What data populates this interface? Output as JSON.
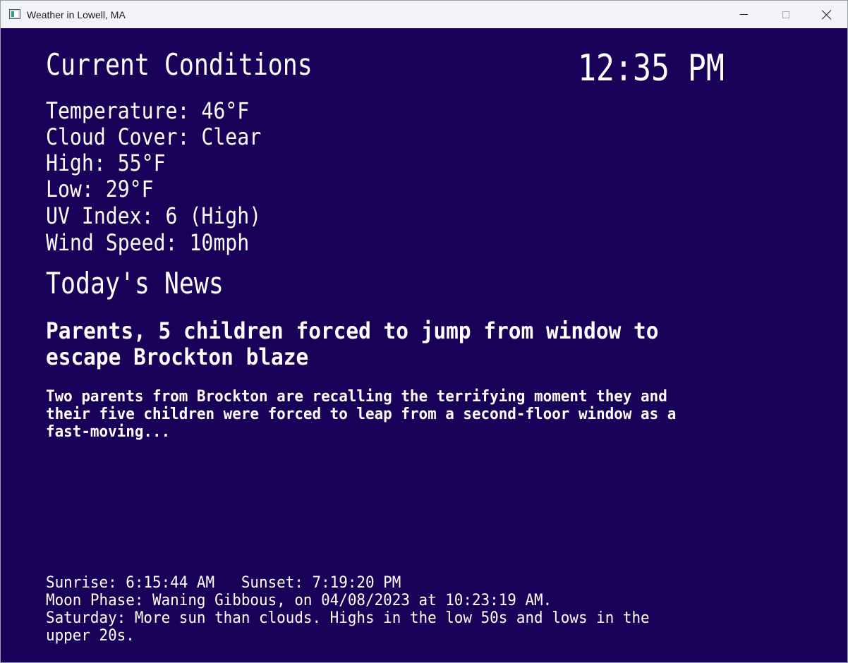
{
  "window": {
    "title": "Weather in Lowell, MA",
    "background": "#190058"
  },
  "conditions": {
    "heading": "Current Conditions",
    "time": "12:35 PM",
    "temperature": "Temperature: 46°F",
    "cloud_cover": "Cloud Cover: Clear",
    "high": "High: 55°F",
    "low": "Low: 29°F",
    "uv_index": "UV Index: 6 (High)",
    "wind_speed": "Wind Speed: 10mph"
  },
  "news": {
    "heading": "Today's News",
    "headline_line1": "Parents, 5 children forced to jump from window to",
    "headline_line2": "escape Brockton blaze",
    "summary_line1": "Two parents from Brockton are recalling the terrifying moment they and",
    "summary_line2": "their five children were forced to leap from a second-floor window as a",
    "summary_line3": "fast-moving..."
  },
  "footer": {
    "sun": "Sunrise: 6:15:44 AM   Sunset: 7:19:20 PM",
    "moon": "Moon Phase: Waning Gibbous, on 04/08/2023 at 10:23:19 AM.",
    "forecast_line1": "Saturday: More sun than clouds. Highs in the low 50s and lows in the",
    "forecast_line2": "upper 20s."
  },
  "icons": {
    "app": "app-window-icon",
    "minimize": "minimize-icon",
    "maximize": "maximize-icon",
    "close": "close-icon"
  }
}
